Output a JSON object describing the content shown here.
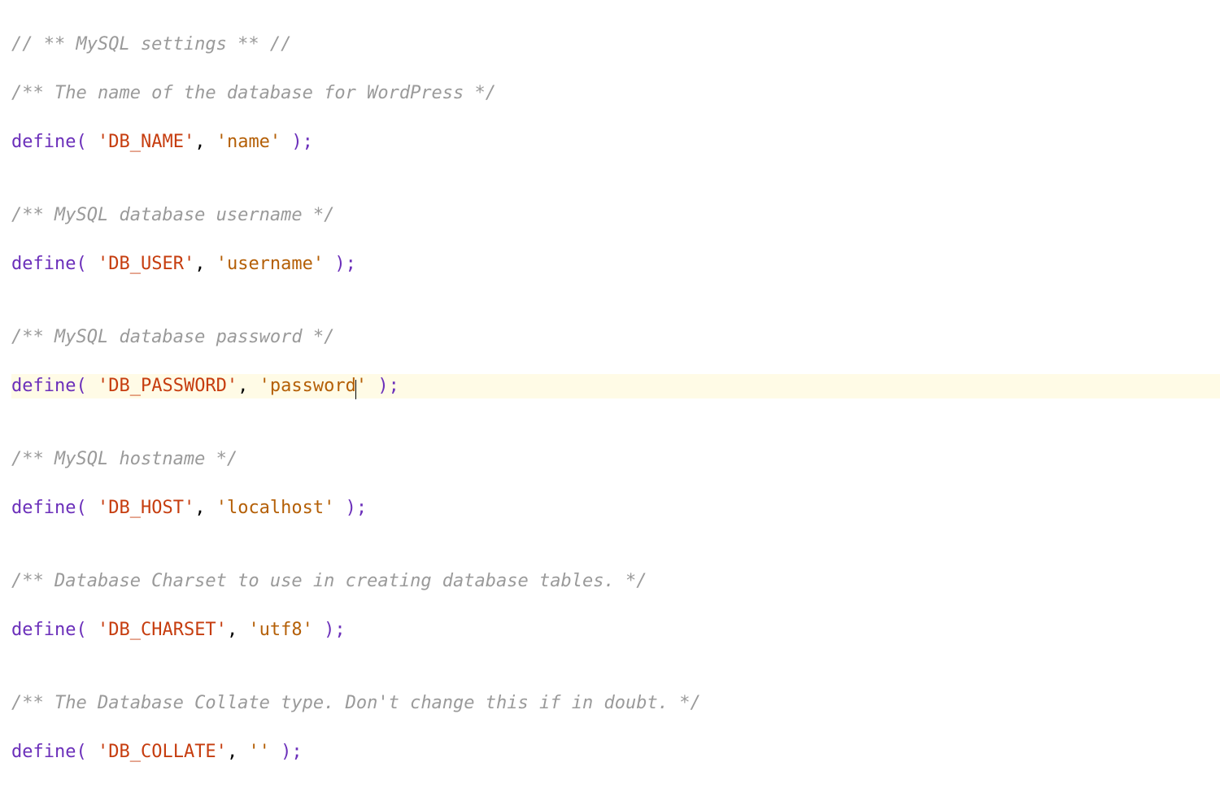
{
  "code": {
    "lines": [
      {
        "type": "comment",
        "text": "// ** MySQL settings ** //"
      },
      {
        "type": "comment",
        "text": "/** The name of the database for WordPress */"
      },
      {
        "type": "define",
        "key_quoted": "'DB_NAME'",
        "value_quoted": "'name'"
      },
      {
        "type": "blank",
        "text": ""
      },
      {
        "type": "comment",
        "text": "/** MySQL database username */"
      },
      {
        "type": "define",
        "key_quoted": "'DB_USER'",
        "value_quoted": "'username'"
      },
      {
        "type": "blank",
        "text": ""
      },
      {
        "type": "comment",
        "text": "/** MySQL database password */"
      },
      {
        "type": "define",
        "key_quoted": "'DB_PASSWORD'",
        "value_quoted": "'password'",
        "highlight": true,
        "caret": true
      },
      {
        "type": "blank",
        "text": ""
      },
      {
        "type": "comment",
        "text": "/** MySQL hostname */"
      },
      {
        "type": "define",
        "key_quoted": "'DB_HOST'",
        "value_quoted": "'localhost'"
      },
      {
        "type": "blank",
        "text": ""
      },
      {
        "type": "comment",
        "text": "/** Database Charset to use in creating database tables. */"
      },
      {
        "type": "define",
        "key_quoted": "'DB_CHARSET'",
        "value_quoted": "'utf8'"
      },
      {
        "type": "blank",
        "text": ""
      },
      {
        "type": "comment",
        "text": "/** The Database Collate type. Don't change this if in doubt. */"
      },
      {
        "type": "define",
        "key_quoted": "'DB_COLLATE'",
        "value_quoted": "''"
      }
    ],
    "tokens": {
      "define": "define",
      "open": "( ",
      "sep": ", ",
      "close": " );"
    }
  }
}
